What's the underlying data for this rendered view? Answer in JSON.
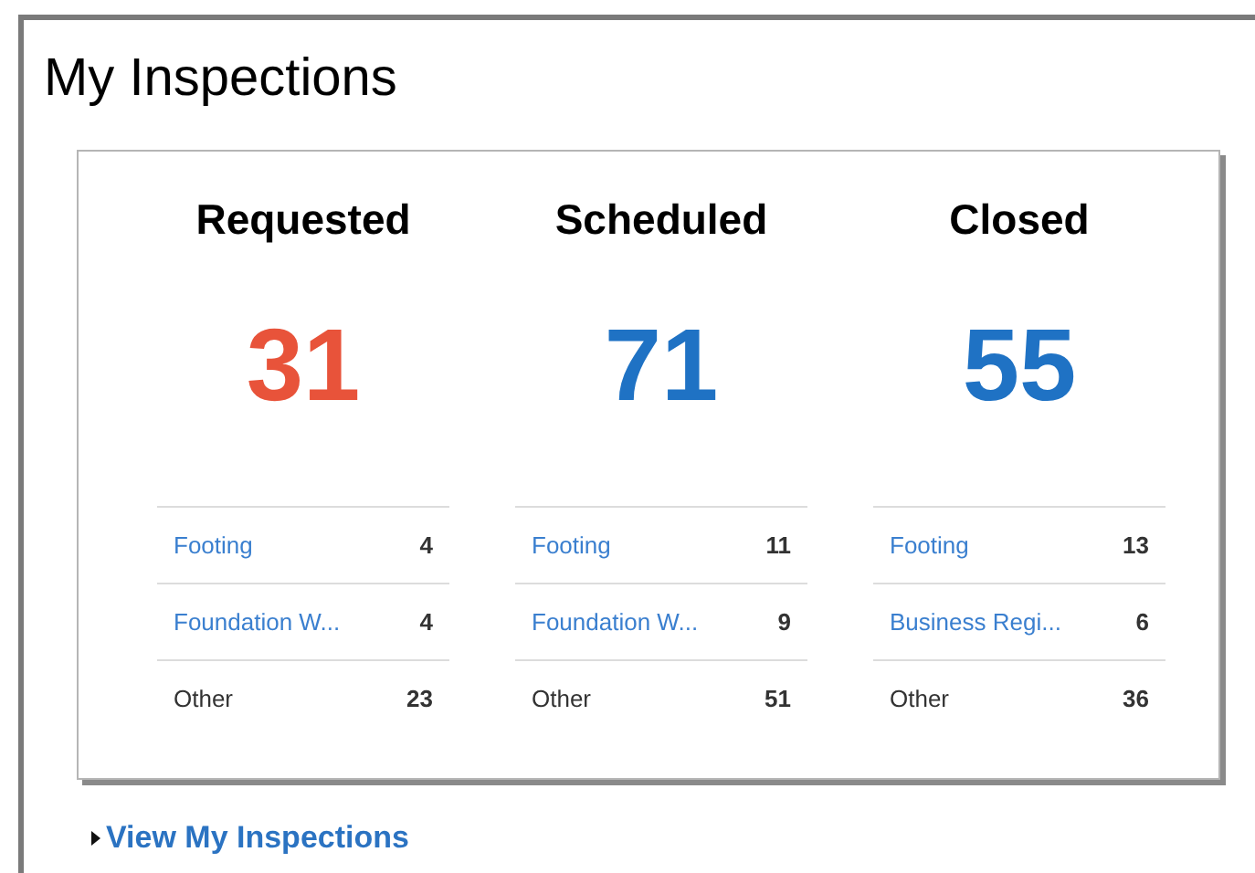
{
  "title": "My Inspections",
  "columns": [
    {
      "heading": "Requested",
      "count": "31",
      "color": "#e8533a",
      "rows": [
        {
          "kind": "link",
          "label": "Footing",
          "value": "4"
        },
        {
          "kind": "link",
          "label": "Foundation W...",
          "value": "4"
        },
        {
          "kind": "plain",
          "label": "Other",
          "value": "23"
        }
      ]
    },
    {
      "heading": "Scheduled",
      "count": "71",
      "color": "#1f72c4",
      "rows": [
        {
          "kind": "link",
          "label": "Footing",
          "value": "11"
        },
        {
          "kind": "link",
          "label": "Foundation W...",
          "value": "9"
        },
        {
          "kind": "plain",
          "label": "Other",
          "value": "51"
        }
      ]
    },
    {
      "heading": "Closed",
      "count": "55",
      "color": "#1f72c4",
      "rows": [
        {
          "kind": "link",
          "label": "Footing",
          "value": "13"
        },
        {
          "kind": "link",
          "label": "Business Regi...",
          "value": "6"
        },
        {
          "kind": "plain",
          "label": "Other",
          "value": "36"
        }
      ]
    }
  ],
  "footer_link": "View My Inspections"
}
